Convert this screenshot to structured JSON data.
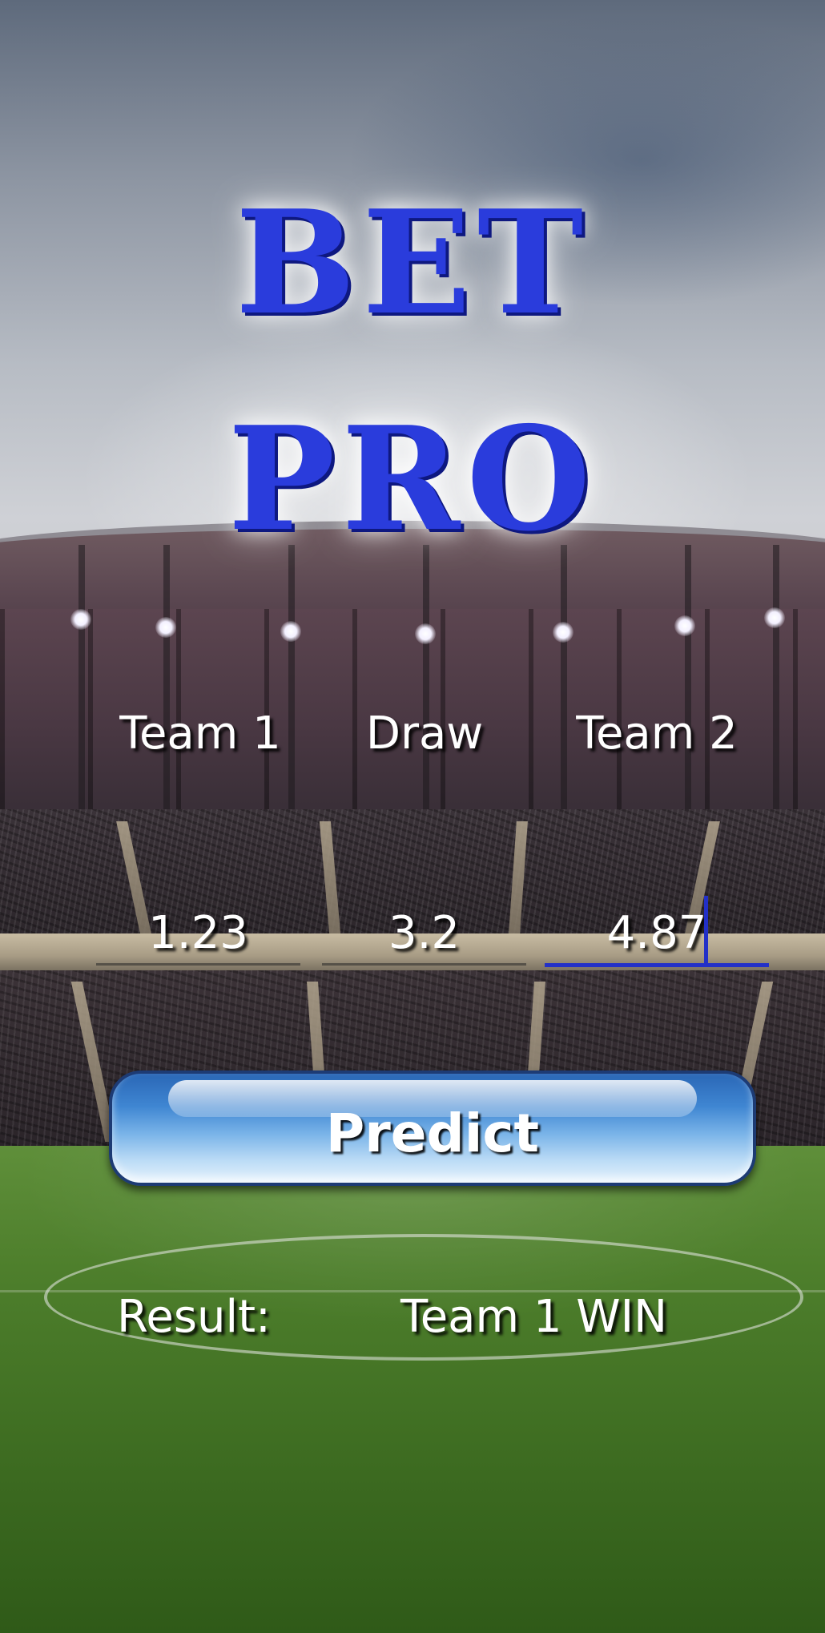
{
  "app": {
    "logo_line1": "BET",
    "logo_line2": "PRO"
  },
  "columns": {
    "team1": "Team 1",
    "draw": "Draw",
    "team2": "Team 2"
  },
  "odds": {
    "team1": "1.23",
    "draw": "3.2",
    "team2": "4.87"
  },
  "predict_button": {
    "label": "Predict"
  },
  "result": {
    "label": "Result:",
    "value": "Team 1 WIN"
  },
  "colors": {
    "logo": "#2a3cdc",
    "focus_underline": "#2230c8",
    "button": "#3f86d2",
    "text": "#ffffff"
  }
}
